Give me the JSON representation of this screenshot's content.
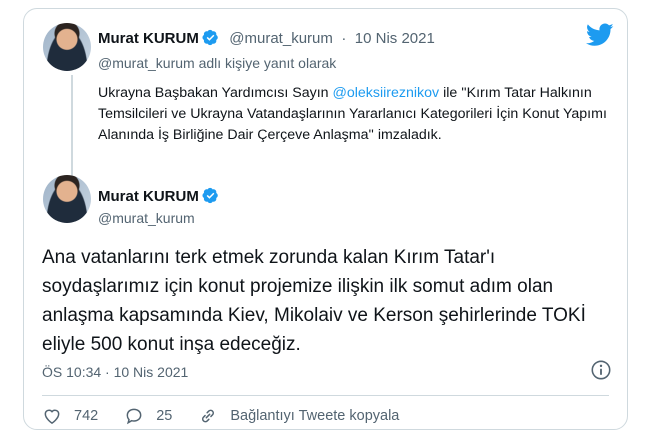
{
  "quoted": {
    "name": "Murat KURUM",
    "handle": "@murat_kurum",
    "separator": "·",
    "date": "10 Nis 2021",
    "reply_note": "@murat_kurum adlı kişiye yanıt olarak",
    "text_before": "Ukrayna Başbakan Yardımcısı Sayın ",
    "mention": "@oleksiireznikov",
    "text_after": " ile ''Kırım Tatar Halkının Temsilcileri ve Ukrayna Vatandaşlarının Yararlanıcı Kategorileri İçin Konut Yapımı Alanında İş Birliğine Dair Çerçeve Anlaşma'' imzaladık."
  },
  "main": {
    "name": "Murat KURUM",
    "handle": "@murat_kurum",
    "text": "Ana vatanlarını terk etmek zorunda kalan Kırım Tatar'ı soydaşlarımız için konut projemize ilişkin ilk somut adım olan anlaşma kapsamında Kiev, Mikolaiv ve Kerson şehirlerinde TOKİ eliyle 500 konut inşa edeceğiz.",
    "time": "ÖS 10:34 · 10 Nis 2021"
  },
  "actions": {
    "likes": "742",
    "replies": "25",
    "copy_link": "Bağlantıyı Tweete kopyala"
  },
  "icons": {
    "brand": "twitter-bird-icon",
    "verified": "verified-badge-icon",
    "info": "info-icon",
    "like": "heart-icon",
    "reply": "reply-bubble-icon",
    "link": "link-icon"
  },
  "colors": {
    "accent": "#1d9bf0",
    "secondary_text": "#536471",
    "border": "#cfd9de"
  }
}
